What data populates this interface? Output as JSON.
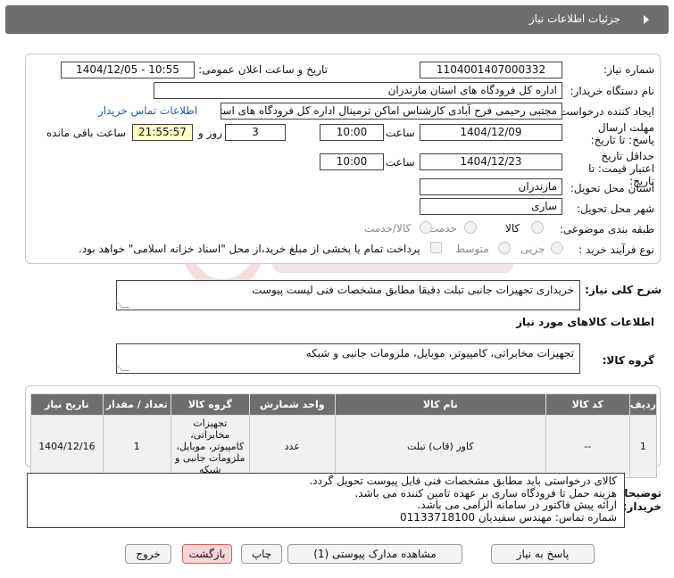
{
  "header": {
    "title": "جزئیات اطلاعات نیاز"
  },
  "form": {
    "need_number": {
      "label": "شماره نیاز:",
      "value": "1104001407000332"
    },
    "announce_datetime": {
      "label": "تاریخ و ساعت اعلان عمومی:",
      "value": "1404/12/05 - 10:55"
    },
    "buyer_org": {
      "label": "نام دستگاه خریدار:",
      "value": "اداره کل فرودگاه های استان مازندران"
    },
    "requester": {
      "label": "ایجاد کننده درخواست:",
      "value": "مجتبی رحیمی فرح آبادی کارشناس اماکن ترمینال اداره کل فرودگاه های استان مازندران",
      "contact_link": "اطلاعات تماس خریدار"
    },
    "reply_deadline": {
      "label": "مهلت ارسال پاسخ: تا تاریخ:",
      "date": "1404/12/09",
      "time_label": "ساعت",
      "time": "10:00",
      "days": "3",
      "days_label": "روز و",
      "remaining": "21:55:57",
      "remaining_label": "ساعت باقی مانده"
    },
    "price_validity": {
      "label": "حداقل تاریخ اعتبار قیمت: تا تاریخ:",
      "date": "1404/12/23",
      "time_label": "ساعت",
      "time": "10:00"
    },
    "delivery_province": {
      "label": "استان محل تحویل:",
      "value": "مازندران"
    },
    "delivery_city": {
      "label": "شهر محل تحویل:",
      "value": "ساری"
    },
    "category": {
      "label": "طبقه بندی موضوعی:",
      "options": [
        "کالا",
        "خدمت",
        "کالا/خدمت"
      ]
    },
    "process": {
      "label": "نوع فرآیند خرید :",
      "options": [
        "جزیی",
        "متوسط"
      ],
      "payment_note": "پرداخت تمام یا بخشی از مبلغ خرید،از محل \"اسناد خزانه اسلامی\" خواهد بود."
    }
  },
  "summary": {
    "label": "شرح کلی نیاز:",
    "value": "خریداری تجهیزات جانبی تبلت دقیقا مطابق مشخصات فنی لیست پیوست"
  },
  "goods_section": {
    "title": "اطلاعات کالاهای مورد نیاز"
  },
  "goods_group": {
    "label": "گروه کالا:",
    "value": "تجهیزات مخابراتی، کامپیوتر، موبایل، ملزومات جانبی و شبکه"
  },
  "table": {
    "headers": [
      "ردیف",
      "کد کالا",
      "نام کالا",
      "واحد شمارش",
      "گروه کالا",
      "تعداد / مقدار",
      "تاریخ نیاز"
    ],
    "rows": [
      {
        "row": "1",
        "code": "--",
        "name": "کاور (قاب) تبلت",
        "unit": "عدد",
        "group": "تجهیزات مخابراتی، کامپیوتر، موبایل، ملزومات جانبی و شبکه",
        "qty": "1",
        "date": "1404/12/16"
      }
    ]
  },
  "buyer_notes": {
    "label": "توضیحات خریدار:",
    "lines": [
      "کالای درخواستی باید مطابق مشخصات فنی فایل پیوست تحویل گردد.",
      "هزینه حمل تا فرودگاه ساری بر عهده تامین کننده می باشد.",
      "ارائه پیش فاکتور در سامانه الزامی می باشد.",
      "شماره تماس: مهندس سفیدیان    01133718100"
    ]
  },
  "buttons": {
    "reply": "پاسخ به نیاز",
    "attachments": "مشاهده مدارک پیوستی (1)",
    "print": "چاپ",
    "back": "بازگشت",
    "exit": "خروج"
  },
  "colors": {
    "header_bg": "#6e6e6e",
    "link": "#1a5fb4",
    "highlight": "#ffffc8",
    "danger_btn": "#fbd5d5"
  }
}
